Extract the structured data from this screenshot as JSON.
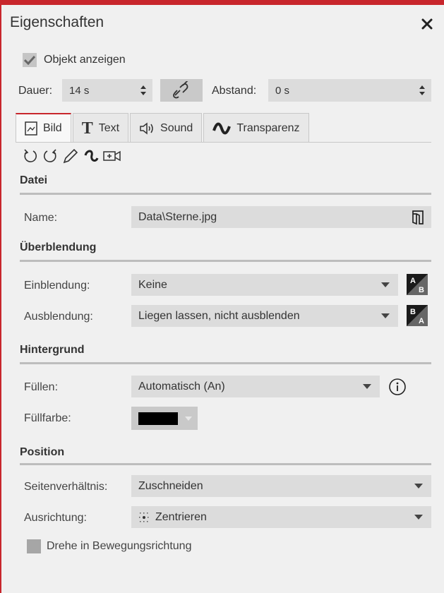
{
  "title": "Eigenschaften",
  "show_object": {
    "label": "Objekt anzeigen",
    "checked": true
  },
  "duration": {
    "label": "Dauer:",
    "value": "14 s"
  },
  "distance": {
    "label": "Abstand:",
    "value": "0 s"
  },
  "tabs": [
    {
      "label": "Bild",
      "icon": "image-icon",
      "active": true
    },
    {
      "label": "Text",
      "icon": "text-T-icon",
      "active": false
    },
    {
      "label": "Sound",
      "icon": "speaker-icon",
      "active": false
    },
    {
      "label": "Transparenz",
      "icon": "transparency-icon",
      "active": false
    }
  ],
  "sections": {
    "datei": {
      "title": "Datei",
      "name_label": "Name:",
      "name_value": "Data\\Sterne.jpg"
    },
    "ueberblendung": {
      "title": "Überblendung",
      "ein_label": "Einblendung:",
      "ein_value": "Keine",
      "aus_label": "Ausblendung:",
      "aus_value": "Liegen lassen, nicht ausblenden"
    },
    "hintergrund": {
      "title": "Hintergrund",
      "fill_label": "Füllen:",
      "fill_value": "Automatisch (An)",
      "color_label": "Füllfarbe:",
      "color_value": "#000000"
    },
    "position": {
      "title": "Position",
      "ratio_label": "Seitenverhältnis:",
      "ratio_value": "Zuschneiden",
      "align_label": "Ausrichtung:",
      "align_value": "Zentrieren",
      "rotate_label": "Drehe in Bewegungsrichtung",
      "rotate_checked": false
    }
  },
  "colors": {
    "accent": "#c8262c",
    "field": "#dcdcdc",
    "rule": "#bdbdbd"
  }
}
